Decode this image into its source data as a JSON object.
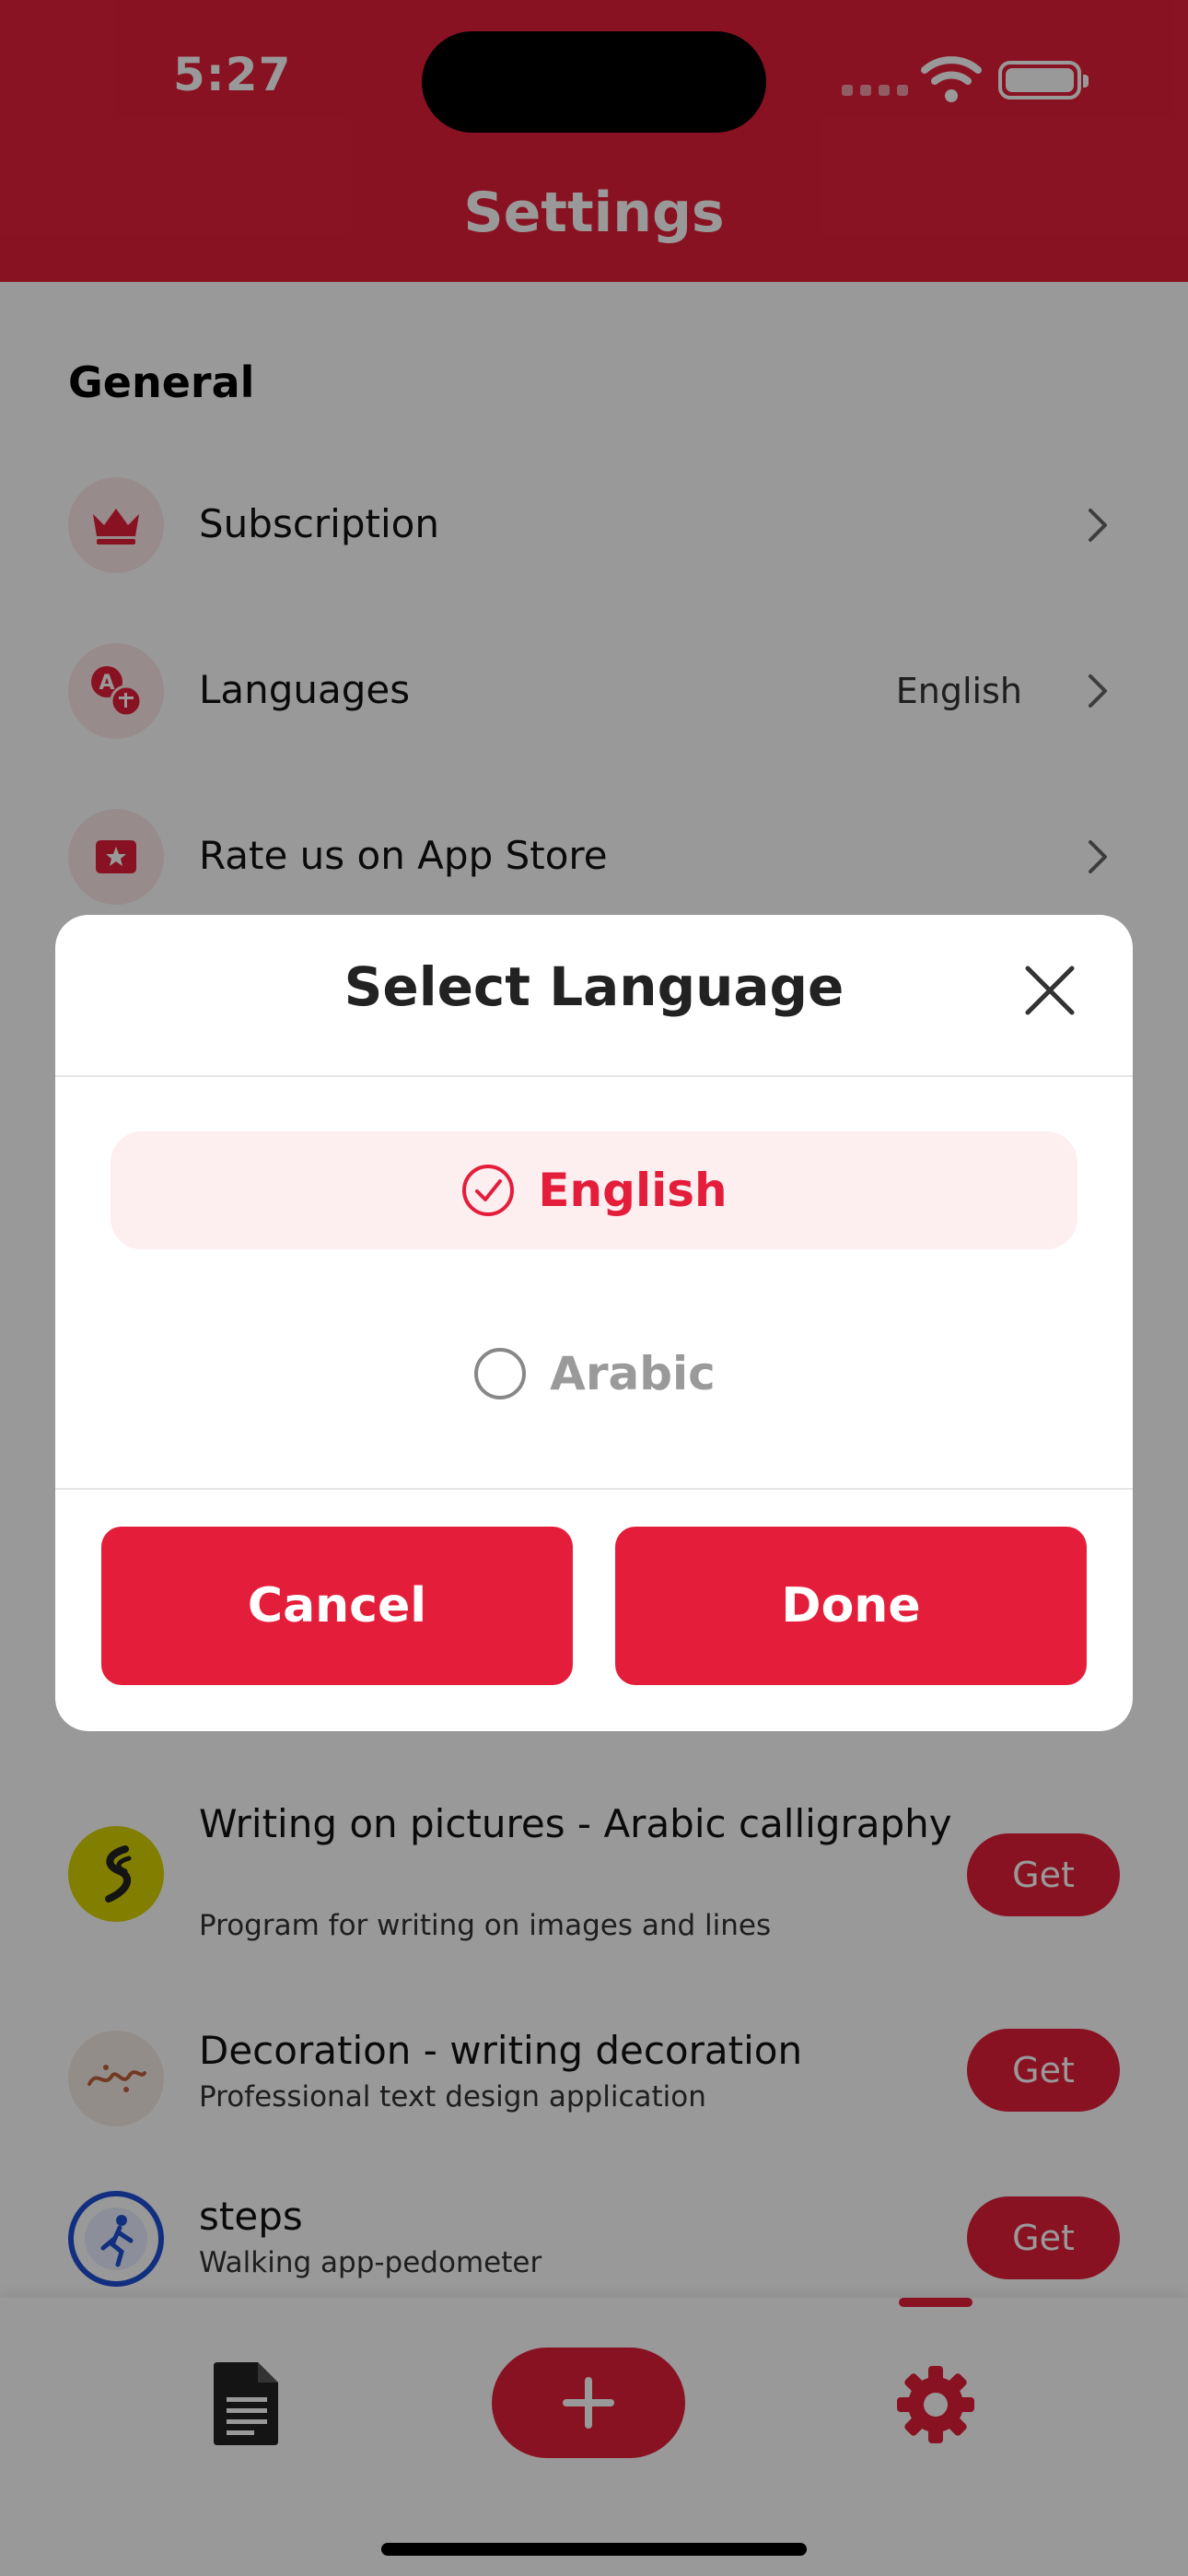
{
  "status_bar": {
    "time": "5:27"
  },
  "header": {
    "title": "Settings"
  },
  "general": {
    "title": "General",
    "rows": [
      {
        "label": "Subscription",
        "value": "",
        "icon": "crown-icon"
      },
      {
        "label": "Languages",
        "value": "English",
        "icon": "translate-icon"
      },
      {
        "label": "Rate us on App Store",
        "value": "",
        "icon": "star-badge-icon"
      }
    ]
  },
  "apps": [
    {
      "name": "Writing on pictures - Arabic calligraphy",
      "desc": "Program for writing on images and lines",
      "button": "Get",
      "logo": "calligraphy-logo"
    },
    {
      "name": "Decoration - writing decoration",
      "desc": "Professional text design application",
      "button": "Get",
      "logo": "zakhrafa-logo"
    },
    {
      "name": "steps",
      "desc": "Walking app-pedometer",
      "button": "Get",
      "logo": "steps-logo"
    }
  ],
  "modal": {
    "title": "Select Language",
    "options": [
      {
        "label": "English",
        "selected": true
      },
      {
        "label": "Arabic",
        "selected": false
      }
    ],
    "cancel": "Cancel",
    "done": "Done"
  },
  "colors": {
    "accent": "#e41e3a",
    "accent_light": "#fdeef0",
    "scrim": "rgba(0,0,0,0.40)"
  }
}
